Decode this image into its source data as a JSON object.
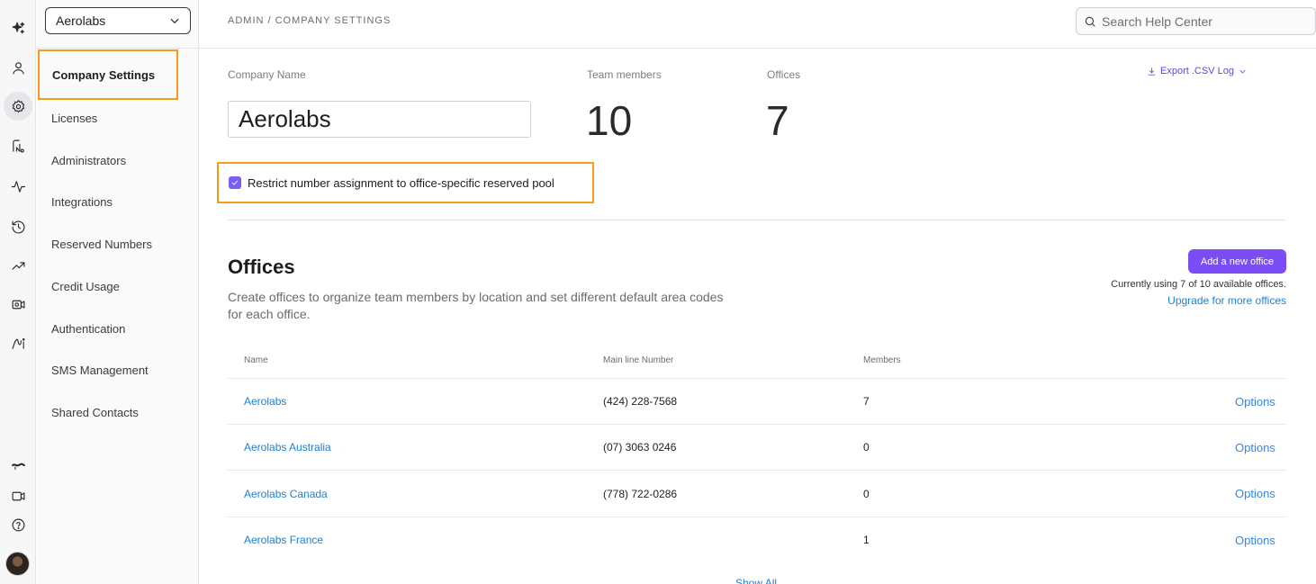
{
  "workspace": {
    "name": "Aerolabs"
  },
  "breadcrumb": "ADMIN / COMPANY SETTINGS",
  "search": {
    "placeholder": "Search Help Center"
  },
  "nav": [
    {
      "label": "Company Settings",
      "selected": true
    },
    {
      "label": "Licenses"
    },
    {
      "label": "Administrators"
    },
    {
      "label": "Integrations"
    },
    {
      "label": "Reserved Numbers"
    },
    {
      "label": "Credit Usage"
    },
    {
      "label": "Authentication"
    },
    {
      "label": "SMS Management"
    },
    {
      "label": "Shared Contacts"
    }
  ],
  "company": {
    "name_label": "Company Name",
    "name_value": "Aerolabs",
    "team_label": "Team members",
    "team_value": "10",
    "offices_label": "Offices",
    "offices_value": "7",
    "export_label": "Export .CSV Log"
  },
  "restrict": {
    "label": "Restrict number assignment to office-specific reserved pool",
    "checked": true
  },
  "offices": {
    "title": "Offices",
    "description": "Create offices to organize team members by location and set different default area codes for each office.",
    "add_button": "Add a new office",
    "usage": "Currently using 7 of 10 available offices.",
    "upgrade": "Upgrade for more offices",
    "columns": [
      "Name",
      "Main line Number",
      "Members"
    ],
    "rows": [
      {
        "name": "Aerolabs",
        "number": "(424) 228-7568",
        "members": "7",
        "action": "Options"
      },
      {
        "name": "Aerolabs Australia",
        "number": "(07) 3063 0246",
        "members": "0",
        "action": "Options"
      },
      {
        "name": "Aerolabs Canada",
        "number": "(778) 722-0286",
        "members": "0",
        "action": "Options"
      },
      {
        "name": "Aerolabs France",
        "number": "",
        "members": "1",
        "action": "Options"
      }
    ],
    "show_all": "Show All"
  },
  "colors": {
    "accent": "#7b4df7",
    "highlight": "#f59c1b",
    "link": "#1a7fd6"
  }
}
